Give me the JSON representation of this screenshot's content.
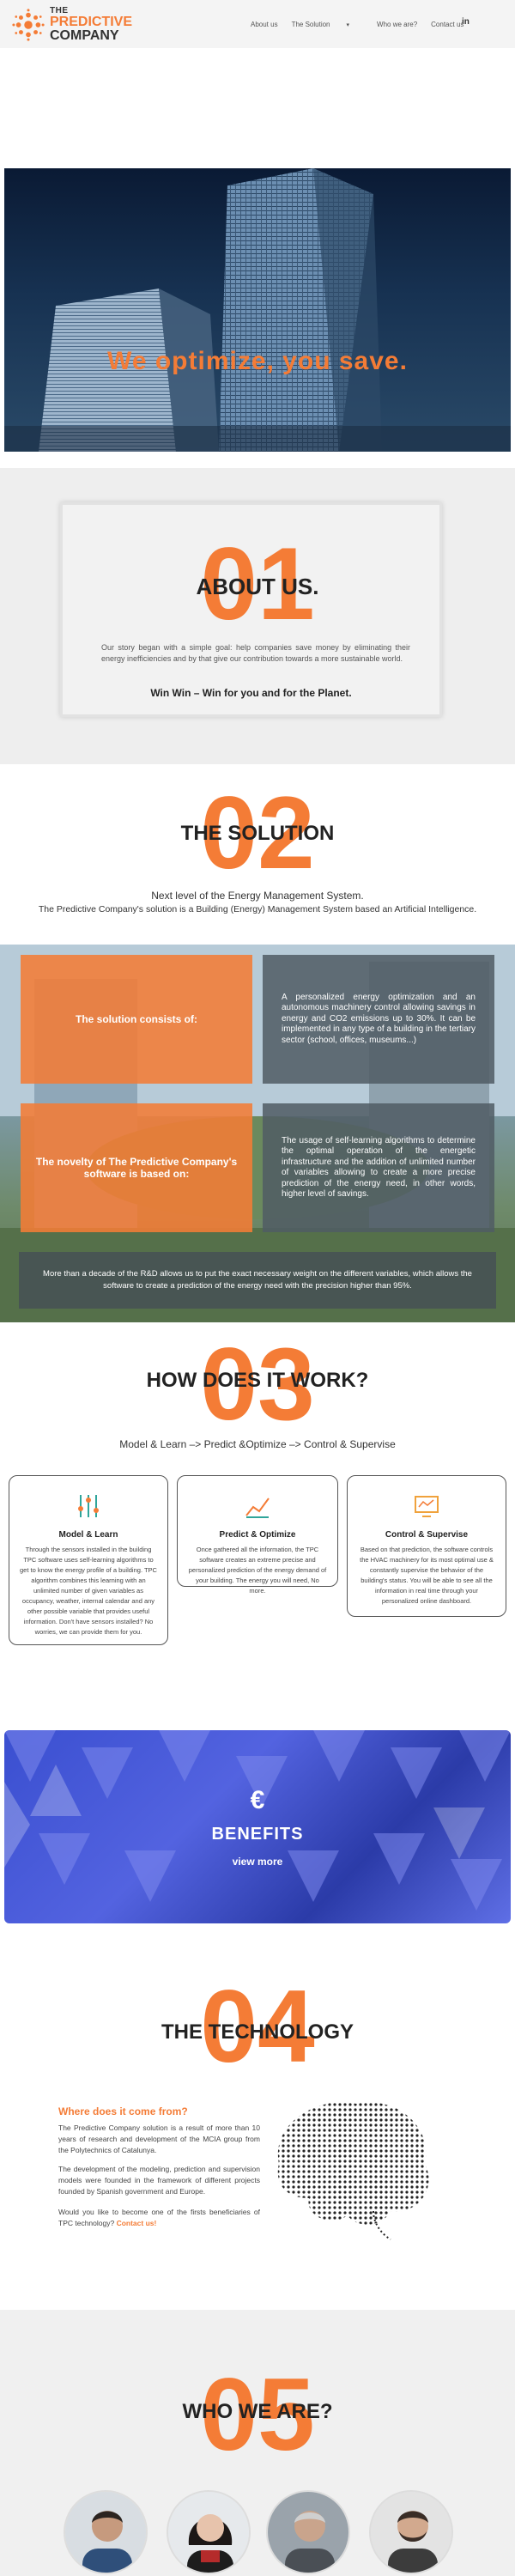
{
  "brand": {
    "the": "THE",
    "predictive": "PREDICTIVE",
    "company": "COMPANY"
  },
  "nav": {
    "items": [
      "About us",
      "The Solution",
      "Who we are?",
      "Contact us"
    ],
    "linkedin": "in"
  },
  "hero": {
    "title": "We optimize, you save."
  },
  "about": {
    "number": "01",
    "title": "ABOUT US.",
    "text": "Our story began with a simple goal: help companies save money by eliminating their energy inefficiencies and by that give our contribution towards a more sustainable world.",
    "tagline": "Win Win – Win for you and for the Planet."
  },
  "solution": {
    "number": "02",
    "title": "THE SOLUTION",
    "subtitle": "Next level of the Energy Management System.",
    "description": "The Predictive Company's solution is a Building (Energy) Management System based an Artificial Intelligence.",
    "box1_label": "The solution consists of:",
    "box1_text": "A personalized energy optimization and an autonomous machinery control allowing savings in energy and CO2 emissions up to 30%. It can be implemented in any type of a building in the tertiary sector (school, offices, museums...)",
    "box2_label": "The novelty of The Predictive Company's software is based on:",
    "box2_text": "The usage of self-learning algorithms to determine the optimal operation of the energetic infrastructure and the addition of unlimited number of variables allowing to create a more precise prediction of the energy need, in other words, higher level of savings.",
    "bottom": "More than a decade of the R&D allows us to put the exact necessary weight on the different variables, which allows the software to create a prediction of the energy need with the precision higher than 95%."
  },
  "how": {
    "number": "03",
    "title": "HOW DOES IT WORK?",
    "subtitle": "Model & Learn –> Predict &Optimize –> Control & Supervise",
    "cards": [
      {
        "icon": "sliders-icon",
        "title": "Model & Learn",
        "text": "Through the sensors installed in the building TPC software uses self-learning algorithms to get to know the energy profile of a building. TPC algorithm combines this learning with an unlimited number of given variables as occupancy, weather, internal calendar and any other possible variable that provides useful information. Don't have sensors installed? No worries, we can provide them for you."
      },
      {
        "icon": "chart-icon",
        "title": "Predict & Optimize",
        "text": "Once gathered all the information, the TPC software creates an extreme precise and personalized prediction of the energy demand of your building. The energy you will need, No more."
      },
      {
        "icon": "monitor-icon",
        "title": "Control & Supervise",
        "text": "Based on that prediction, the software controls the HVAC machinery for its most optimal use & constantly supervise the behavior of the building's status. You will be able to see all the information in real time through your personalized online dashboard."
      }
    ]
  },
  "benefits": {
    "symbol": "€",
    "title": "BENEFITS",
    "link": "view more"
  },
  "technology": {
    "number": "04",
    "title": "THE TECHNOLOGY",
    "question": "Where does it come from?",
    "p1": "The Predictive Company solution is a result of more than 10 years of research and development of the MCIA group from the Polytechnics of Catalunya.",
    "p2": "The development of the modeling, prediction and supervision models were founded in the framework of different projects founded by Spanish government and Europe.",
    "p3": "Would you like to become one of the firsts beneficiaries of TPC technology?",
    "contact": "Contact us!"
  },
  "who": {
    "number": "05",
    "title": "WHO WE ARE?"
  },
  "colors": {
    "accent": "#f47c36",
    "dark": "#222222",
    "benefits_blue": "#4a5ad8"
  }
}
